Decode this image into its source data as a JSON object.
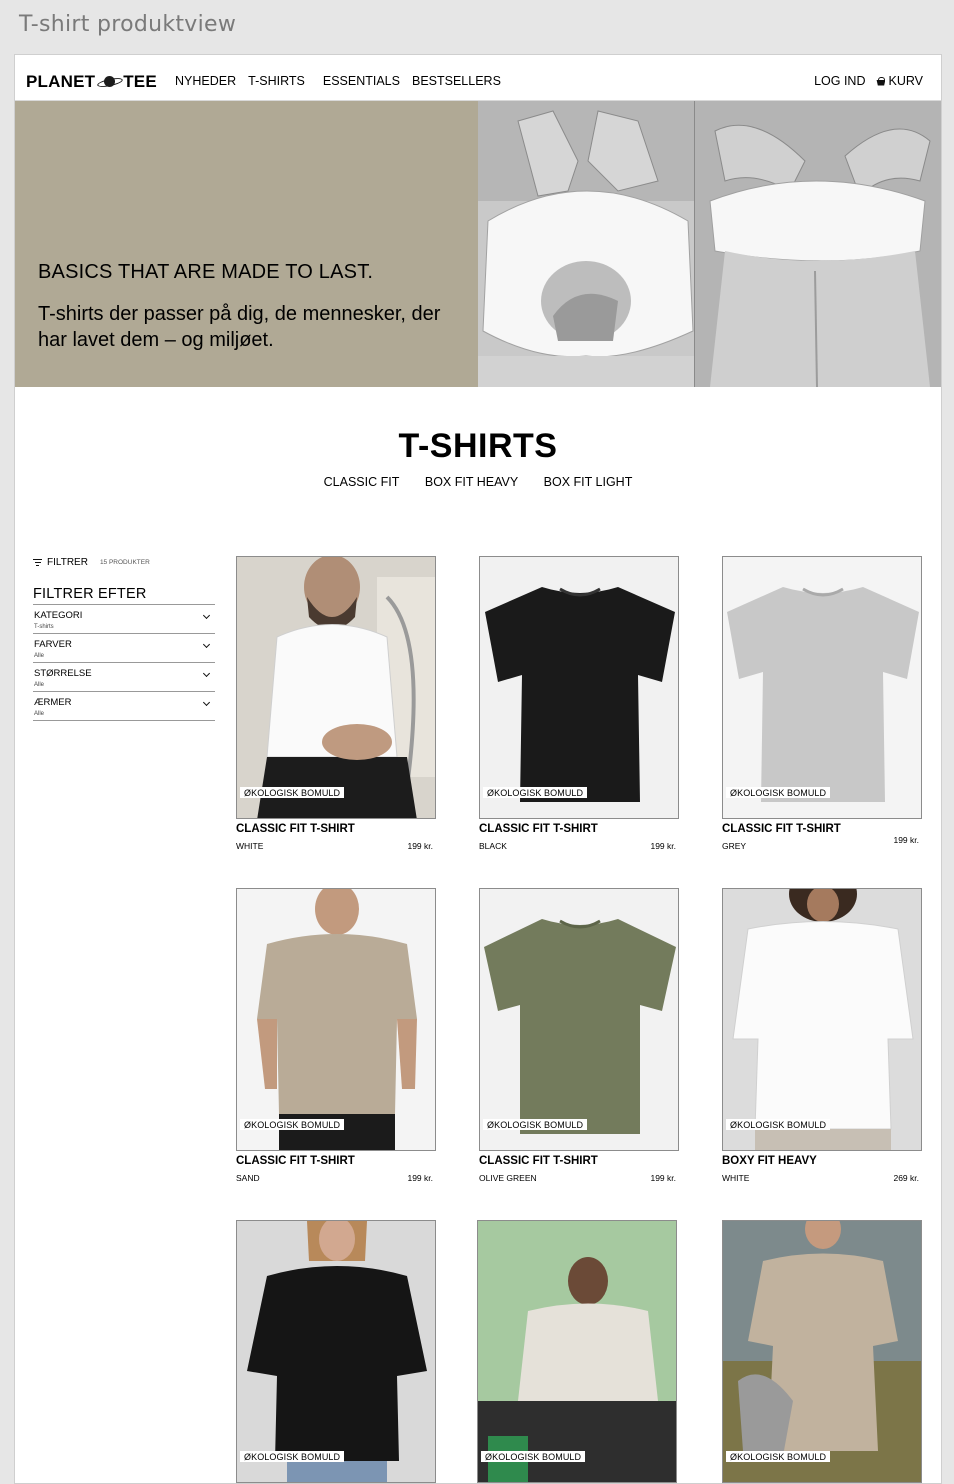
{
  "frame_title": "T-shirt produktview",
  "header": {
    "logo_left": "PLANET",
    "logo_right": "TEE",
    "nav": [
      "NYHEDER",
      "T-SHIRTS",
      "ESSENTIALS",
      "BESTSELLERS"
    ],
    "login": "LOG IND",
    "cart": "KURV"
  },
  "hero": {
    "headline": "BASICS THAT ARE MADE TO LAST.",
    "subtext": "T-shirts der passer på dig, de mennesker, der har lavet dem – og miljøet."
  },
  "section": {
    "title": "T-SHIRTS",
    "subnav": [
      "CLASSIC FIT",
      "BOX FIT HEAVY",
      "BOX FIT LIGHT"
    ]
  },
  "filter": {
    "label": "FILTRER",
    "count": "15 PRODUKTER",
    "heading": "FILTRER EFTER",
    "groups": [
      {
        "name": "KATEGORI",
        "value": "T-shirts"
      },
      {
        "name": "FARVER",
        "value": "Alle"
      },
      {
        "name": "STØRRELSE",
        "value": "Alle"
      },
      {
        "name": "ÆRMER",
        "value": "Alle"
      }
    ]
  },
  "products": [
    {
      "name": "CLASSIC FIT T-SHIRT",
      "color": "WHITE",
      "price": "199 kr.",
      "badge": "ØKOLOGISK BOMULD"
    },
    {
      "name": "CLASSIC FIT T-SHIRT",
      "color": "BLACK",
      "price": "199 kr.",
      "badge": "ØKOLOGISK BOMULD"
    },
    {
      "name": "CLASSIC FIT T-SHIRT",
      "color": "GREY",
      "price": "199 kr.",
      "badge": "ØKOLOGISK BOMULD"
    },
    {
      "name": "CLASSIC FIT T-SHIRT",
      "color": "SAND",
      "price": "199 kr.",
      "badge": "ØKOLOGISK BOMULD"
    },
    {
      "name": "CLASSIC FIT T-SHIRT",
      "color": "OLIVE GREEN",
      "price": "199 kr.",
      "badge": "ØKOLOGISK BOMULD"
    },
    {
      "name": "BOXY FIT HEAVY",
      "color": "WHITE",
      "price": "269 kr.",
      "badge": "ØKOLOGISK BOMULD"
    },
    {
      "badge": "ØKOLOGISK BOMULD"
    },
    {
      "badge": "ØKOLOGISK BOMULD"
    },
    {
      "badge": "ØKOLOGISK BOMULD"
    }
  ],
  "colors": {
    "hero_bg": "#b0a995",
    "page_bg": "#ffffff",
    "frame_bg": "#e6e6e6"
  }
}
